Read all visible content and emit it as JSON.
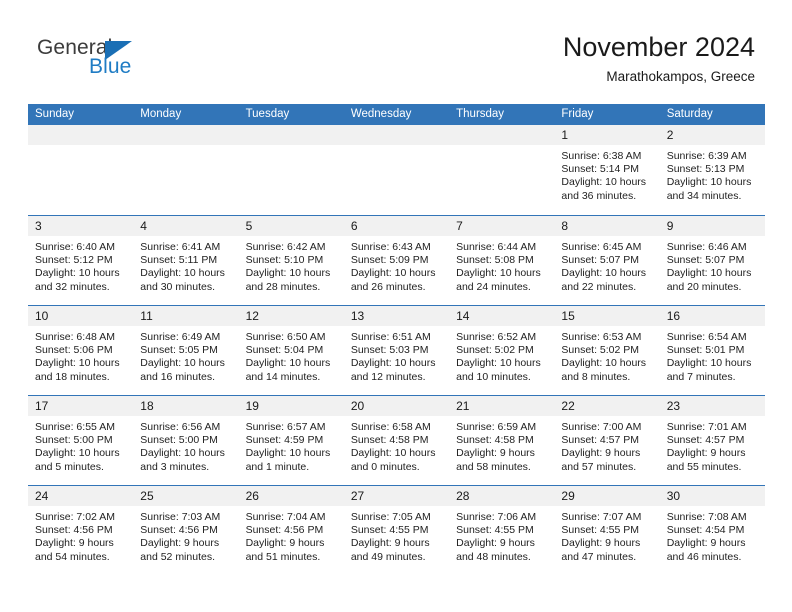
{
  "brand": {
    "word1": "General",
    "word2": "Blue",
    "triangle_color": "#1a6fb5",
    "text_color": "#3c3c3c",
    "blue_text_color": "#1f7cc4"
  },
  "header": {
    "title": "November 2024",
    "subtitle": "Marathokampos, Greece",
    "header_bg": "#3275b8"
  },
  "calendar": {
    "weekday_headers": [
      "Sunday",
      "Monday",
      "Tuesday",
      "Wednesday",
      "Thursday",
      "Friday",
      "Saturday"
    ],
    "weeks": [
      [
        {
          "day": "",
          "sunrise": "",
          "sunset": "",
          "daylight_line1": "",
          "daylight_line2": ""
        },
        {
          "day": "",
          "sunrise": "",
          "sunset": "",
          "daylight_line1": "",
          "daylight_line2": ""
        },
        {
          "day": "",
          "sunrise": "",
          "sunset": "",
          "daylight_line1": "",
          "daylight_line2": ""
        },
        {
          "day": "",
          "sunrise": "",
          "sunset": "",
          "daylight_line1": "",
          "daylight_line2": ""
        },
        {
          "day": "",
          "sunrise": "",
          "sunset": "",
          "daylight_line1": "",
          "daylight_line2": ""
        },
        {
          "day": "1",
          "sunrise": "Sunrise: 6:38 AM",
          "sunset": "Sunset: 5:14 PM",
          "daylight_line1": "Daylight: 10 hours",
          "daylight_line2": "and 36 minutes."
        },
        {
          "day": "2",
          "sunrise": "Sunrise: 6:39 AM",
          "sunset": "Sunset: 5:13 PM",
          "daylight_line1": "Daylight: 10 hours",
          "daylight_line2": "and 34 minutes."
        }
      ],
      [
        {
          "day": "3",
          "sunrise": "Sunrise: 6:40 AM",
          "sunset": "Sunset: 5:12 PM",
          "daylight_line1": "Daylight: 10 hours",
          "daylight_line2": "and 32 minutes."
        },
        {
          "day": "4",
          "sunrise": "Sunrise: 6:41 AM",
          "sunset": "Sunset: 5:11 PM",
          "daylight_line1": "Daylight: 10 hours",
          "daylight_line2": "and 30 minutes."
        },
        {
          "day": "5",
          "sunrise": "Sunrise: 6:42 AM",
          "sunset": "Sunset: 5:10 PM",
          "daylight_line1": "Daylight: 10 hours",
          "daylight_line2": "and 28 minutes."
        },
        {
          "day": "6",
          "sunrise": "Sunrise: 6:43 AM",
          "sunset": "Sunset: 5:09 PM",
          "daylight_line1": "Daylight: 10 hours",
          "daylight_line2": "and 26 minutes."
        },
        {
          "day": "7",
          "sunrise": "Sunrise: 6:44 AM",
          "sunset": "Sunset: 5:08 PM",
          "daylight_line1": "Daylight: 10 hours",
          "daylight_line2": "and 24 minutes."
        },
        {
          "day": "8",
          "sunrise": "Sunrise: 6:45 AM",
          "sunset": "Sunset: 5:07 PM",
          "daylight_line1": "Daylight: 10 hours",
          "daylight_line2": "and 22 minutes."
        },
        {
          "day": "9",
          "sunrise": "Sunrise: 6:46 AM",
          "sunset": "Sunset: 5:07 PM",
          "daylight_line1": "Daylight: 10 hours",
          "daylight_line2": "and 20 minutes."
        }
      ],
      [
        {
          "day": "10",
          "sunrise": "Sunrise: 6:48 AM",
          "sunset": "Sunset: 5:06 PM",
          "daylight_line1": "Daylight: 10 hours",
          "daylight_line2": "and 18 minutes."
        },
        {
          "day": "11",
          "sunrise": "Sunrise: 6:49 AM",
          "sunset": "Sunset: 5:05 PM",
          "daylight_line1": "Daylight: 10 hours",
          "daylight_line2": "and 16 minutes."
        },
        {
          "day": "12",
          "sunrise": "Sunrise: 6:50 AM",
          "sunset": "Sunset: 5:04 PM",
          "daylight_line1": "Daylight: 10 hours",
          "daylight_line2": "and 14 minutes."
        },
        {
          "day": "13",
          "sunrise": "Sunrise: 6:51 AM",
          "sunset": "Sunset: 5:03 PM",
          "daylight_line1": "Daylight: 10 hours",
          "daylight_line2": "and 12 minutes."
        },
        {
          "day": "14",
          "sunrise": "Sunrise: 6:52 AM",
          "sunset": "Sunset: 5:02 PM",
          "daylight_line1": "Daylight: 10 hours",
          "daylight_line2": "and 10 minutes."
        },
        {
          "day": "15",
          "sunrise": "Sunrise: 6:53 AM",
          "sunset": "Sunset: 5:02 PM",
          "daylight_line1": "Daylight: 10 hours",
          "daylight_line2": "and 8 minutes."
        },
        {
          "day": "16",
          "sunrise": "Sunrise: 6:54 AM",
          "sunset": "Sunset: 5:01 PM",
          "daylight_line1": "Daylight: 10 hours",
          "daylight_line2": "and 7 minutes."
        }
      ],
      [
        {
          "day": "17",
          "sunrise": "Sunrise: 6:55 AM",
          "sunset": "Sunset: 5:00 PM",
          "daylight_line1": "Daylight: 10 hours",
          "daylight_line2": "and 5 minutes."
        },
        {
          "day": "18",
          "sunrise": "Sunrise: 6:56 AM",
          "sunset": "Sunset: 5:00 PM",
          "daylight_line1": "Daylight: 10 hours",
          "daylight_line2": "and 3 minutes."
        },
        {
          "day": "19",
          "sunrise": "Sunrise: 6:57 AM",
          "sunset": "Sunset: 4:59 PM",
          "daylight_line1": "Daylight: 10 hours",
          "daylight_line2": "and 1 minute."
        },
        {
          "day": "20",
          "sunrise": "Sunrise: 6:58 AM",
          "sunset": "Sunset: 4:58 PM",
          "daylight_line1": "Daylight: 10 hours",
          "daylight_line2": "and 0 minutes."
        },
        {
          "day": "21",
          "sunrise": "Sunrise: 6:59 AM",
          "sunset": "Sunset: 4:58 PM",
          "daylight_line1": "Daylight: 9 hours",
          "daylight_line2": "and 58 minutes."
        },
        {
          "day": "22",
          "sunrise": "Sunrise: 7:00 AM",
          "sunset": "Sunset: 4:57 PM",
          "daylight_line1": "Daylight: 9 hours",
          "daylight_line2": "and 57 minutes."
        },
        {
          "day": "23",
          "sunrise": "Sunrise: 7:01 AM",
          "sunset": "Sunset: 4:57 PM",
          "daylight_line1": "Daylight: 9 hours",
          "daylight_line2": "and 55 minutes."
        }
      ],
      [
        {
          "day": "24",
          "sunrise": "Sunrise: 7:02 AM",
          "sunset": "Sunset: 4:56 PM",
          "daylight_line1": "Daylight: 9 hours",
          "daylight_line2": "and 54 minutes."
        },
        {
          "day": "25",
          "sunrise": "Sunrise: 7:03 AM",
          "sunset": "Sunset: 4:56 PM",
          "daylight_line1": "Daylight: 9 hours",
          "daylight_line2": "and 52 minutes."
        },
        {
          "day": "26",
          "sunrise": "Sunrise: 7:04 AM",
          "sunset": "Sunset: 4:56 PM",
          "daylight_line1": "Daylight: 9 hours",
          "daylight_line2": "and 51 minutes."
        },
        {
          "day": "27",
          "sunrise": "Sunrise: 7:05 AM",
          "sunset": "Sunset: 4:55 PM",
          "daylight_line1": "Daylight: 9 hours",
          "daylight_line2": "and 49 minutes."
        },
        {
          "day": "28",
          "sunrise": "Sunrise: 7:06 AM",
          "sunset": "Sunset: 4:55 PM",
          "daylight_line1": "Daylight: 9 hours",
          "daylight_line2": "and 48 minutes."
        },
        {
          "day": "29",
          "sunrise": "Sunrise: 7:07 AM",
          "sunset": "Sunset: 4:55 PM",
          "daylight_line1": "Daylight: 9 hours",
          "daylight_line2": "and 47 minutes."
        },
        {
          "day": "30",
          "sunrise": "Sunrise: 7:08 AM",
          "sunset": "Sunset: 4:54 PM",
          "daylight_line1": "Daylight: 9 hours",
          "daylight_line2": "and 46 minutes."
        }
      ]
    ]
  }
}
